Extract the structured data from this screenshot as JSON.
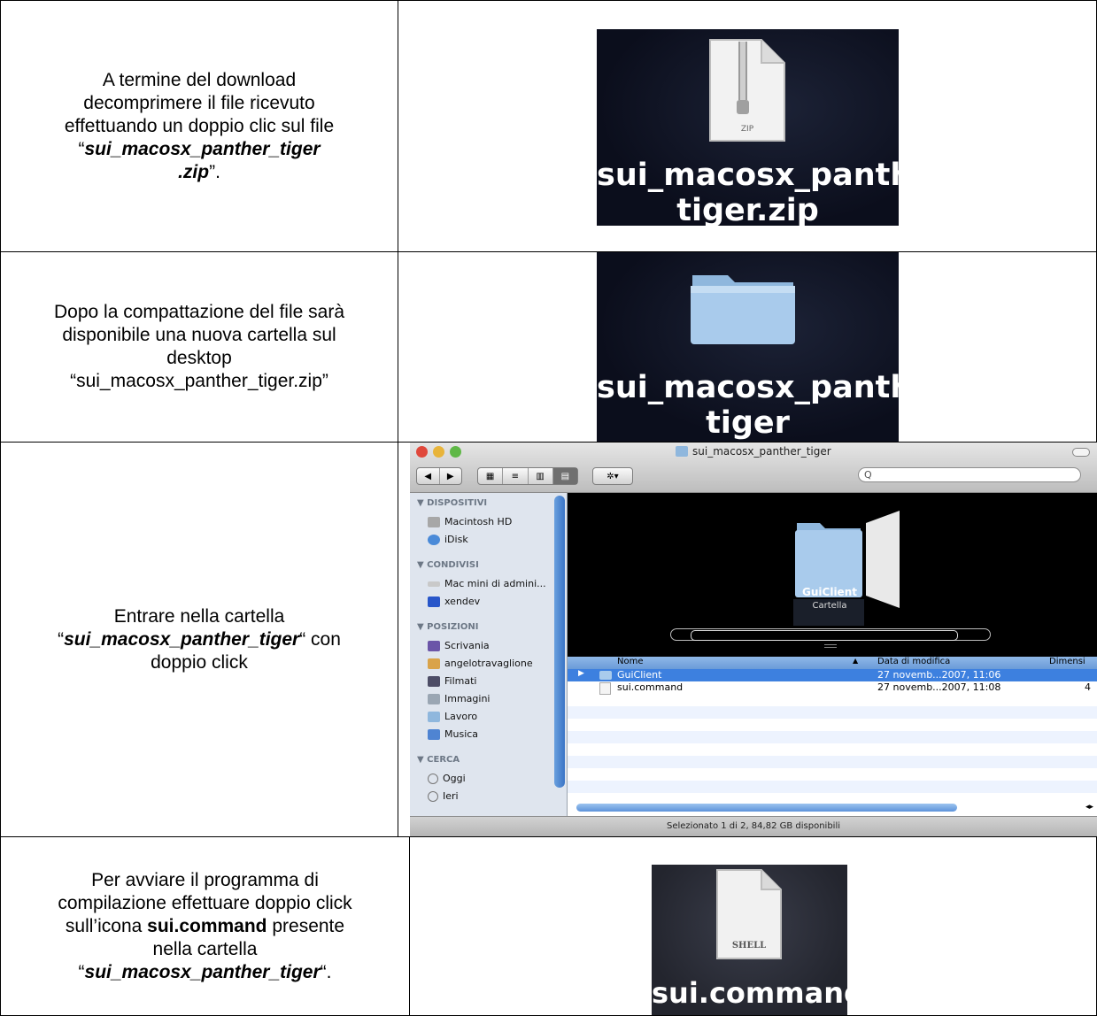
{
  "rows": [
    {
      "text_lines": [
        "A termine del download",
        "decomprimere il file ricevuto",
        "effettuando un doppio clic sul file"
      ],
      "quote_open": "“",
      "bold_part1": "sui_macosx_panther_tiger",
      "bold_part2": ".zip",
      "quote_close": "”.",
      "image_label_1": "sui_macosx_panther_",
      "image_label_2": "tiger.zip",
      "icon_caption": "ZIP"
    },
    {
      "text_lines": [
        "Dopo la compattazione del file sarà",
        "disponibile una nuova cartella sul",
        "desktop",
        "“sui_macosx_panther_tiger.zip”"
      ],
      "image_label_1": "sui_macosx_panther_",
      "image_label_2": "tiger"
    },
    {
      "text_line1": "Entrare nella cartella",
      "quote_open": "“",
      "bold": "sui_macosx_panther_tiger",
      "after": "“ con",
      "text_line3": "doppio click"
    },
    {
      "text_lines": [
        "Per avviare il programma di",
        "compilazione effettuare doppio click"
      ],
      "line3_pre": "sull’icona ",
      "line3_bold": "sui.command",
      "line3_post": " presente",
      "line4": "nella cartella",
      "quote_open": "“",
      "bold": "sui_macosx_panther_tiger",
      "quote_close": "“.",
      "image_label": "sui.command",
      "icon_caption": "SHELL"
    }
  ],
  "finder": {
    "window_title": "sui_macosx_panther_tiger",
    "search_placeholder": "Q",
    "sidebar": {
      "sections": [
        {
          "title": "▼ DISPOSITIVI",
          "items": [
            "Macintosh HD",
            "iDisk"
          ]
        },
        {
          "title": "▼ CONDIVISI",
          "items": [
            "Mac mini di admini...",
            "xendev"
          ]
        },
        {
          "title": "▼ POSIZIONI",
          "items": [
            "Scrivania",
            "angelotravaglione",
            "Filmati",
            "Immagini",
            "Lavoro",
            "Musica"
          ]
        },
        {
          "title": "▼ CERCA",
          "items": [
            "Oggi",
            "Ieri"
          ]
        }
      ]
    },
    "coverflow": {
      "name": "GuiClient",
      "kind": "Cartella"
    },
    "columns": [
      "Nome",
      "Data di modifica",
      "Dimensi"
    ],
    "files": [
      {
        "name": "GuiClient",
        "date": "27 novemb...2007, 11:06",
        "size": ""
      },
      {
        "name": "sui.command",
        "date": "27 novemb...2007, 11:08",
        "size": "4"
      }
    ],
    "status": "Selezionato 1 di 2, 84,82 GB disponibili",
    "colors": {
      "selection": "#3d80df",
      "sidebar": "#dfe5ee"
    }
  }
}
